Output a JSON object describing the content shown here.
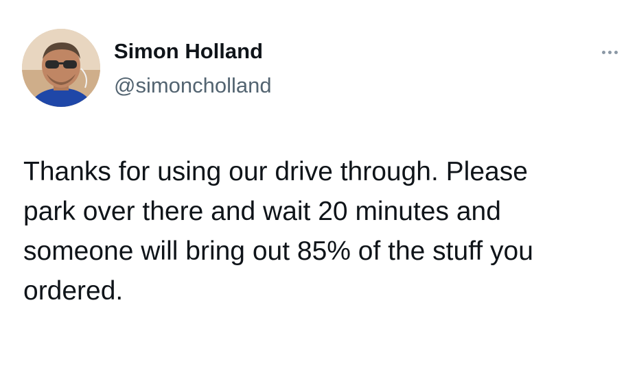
{
  "author": {
    "display_name": "Simon Holland",
    "handle": "@simoncholland",
    "avatar_icon": "profile-photo"
  },
  "menu": {
    "more_icon": "more-options-icon"
  },
  "tweet": {
    "text_lines": [
      "Thanks for using our drive through. Please",
      "park over there and wait 20 minutes and",
      "someone will bring out 85% of the stuff you",
      "ordered."
    ]
  }
}
